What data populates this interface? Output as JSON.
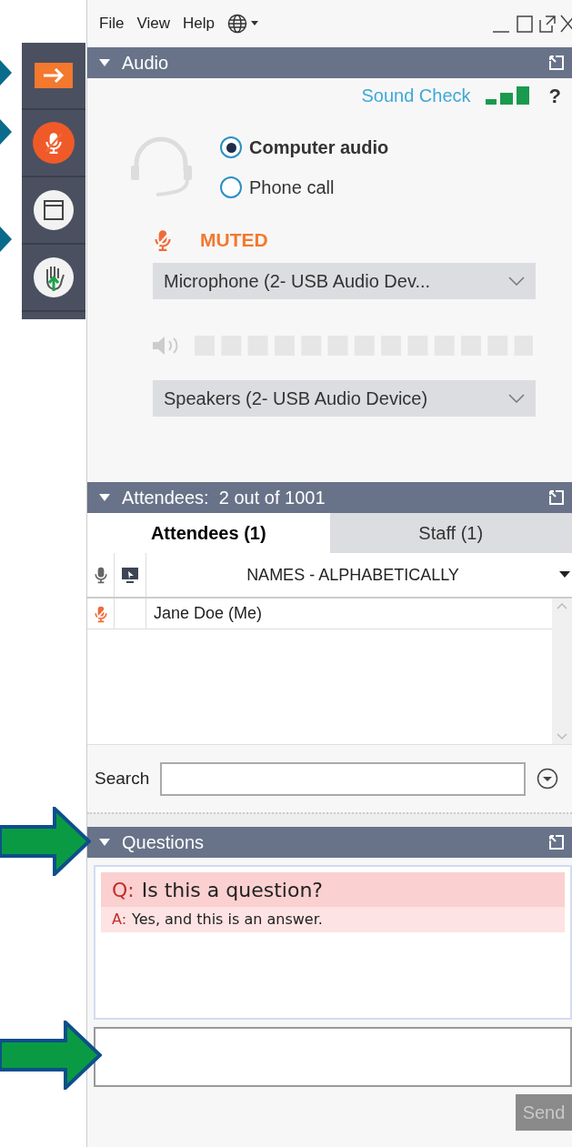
{
  "menu": [
    "File",
    "View",
    "Help"
  ],
  "audio": {
    "title": "Audio",
    "sound_check": "Sound Check",
    "help": "?",
    "muted": true,
    "muted_label": "MUTED",
    "options": [
      {
        "label": "Computer audio",
        "selected": true
      },
      {
        "label": "Phone call",
        "selected": false
      }
    ],
    "microphone": "Microphone (2- USB Audio Dev...",
    "speakers": "Speakers (2- USB Audio Device)"
  },
  "attendees": {
    "title": "Attendees:  2 out of 1001",
    "tabs": [
      {
        "label": "Attendees (1)",
        "selected": true
      },
      {
        "label": "Staff (1)",
        "selected": false
      }
    ],
    "column": "NAMES - ALPHABETICALLY",
    "rows": [
      {
        "name": "Jane Doe (Me)",
        "muted": true
      }
    ],
    "search_label": "Search"
  },
  "questions": {
    "title": "Questions",
    "items": [
      {
        "q_label": "Q:",
        "question": "Is this a question?",
        "a_label": "A:",
        "answer": "Yes, and this is an answer."
      }
    ],
    "send": {
      "label": "Send",
      "disabled": true
    }
  }
}
